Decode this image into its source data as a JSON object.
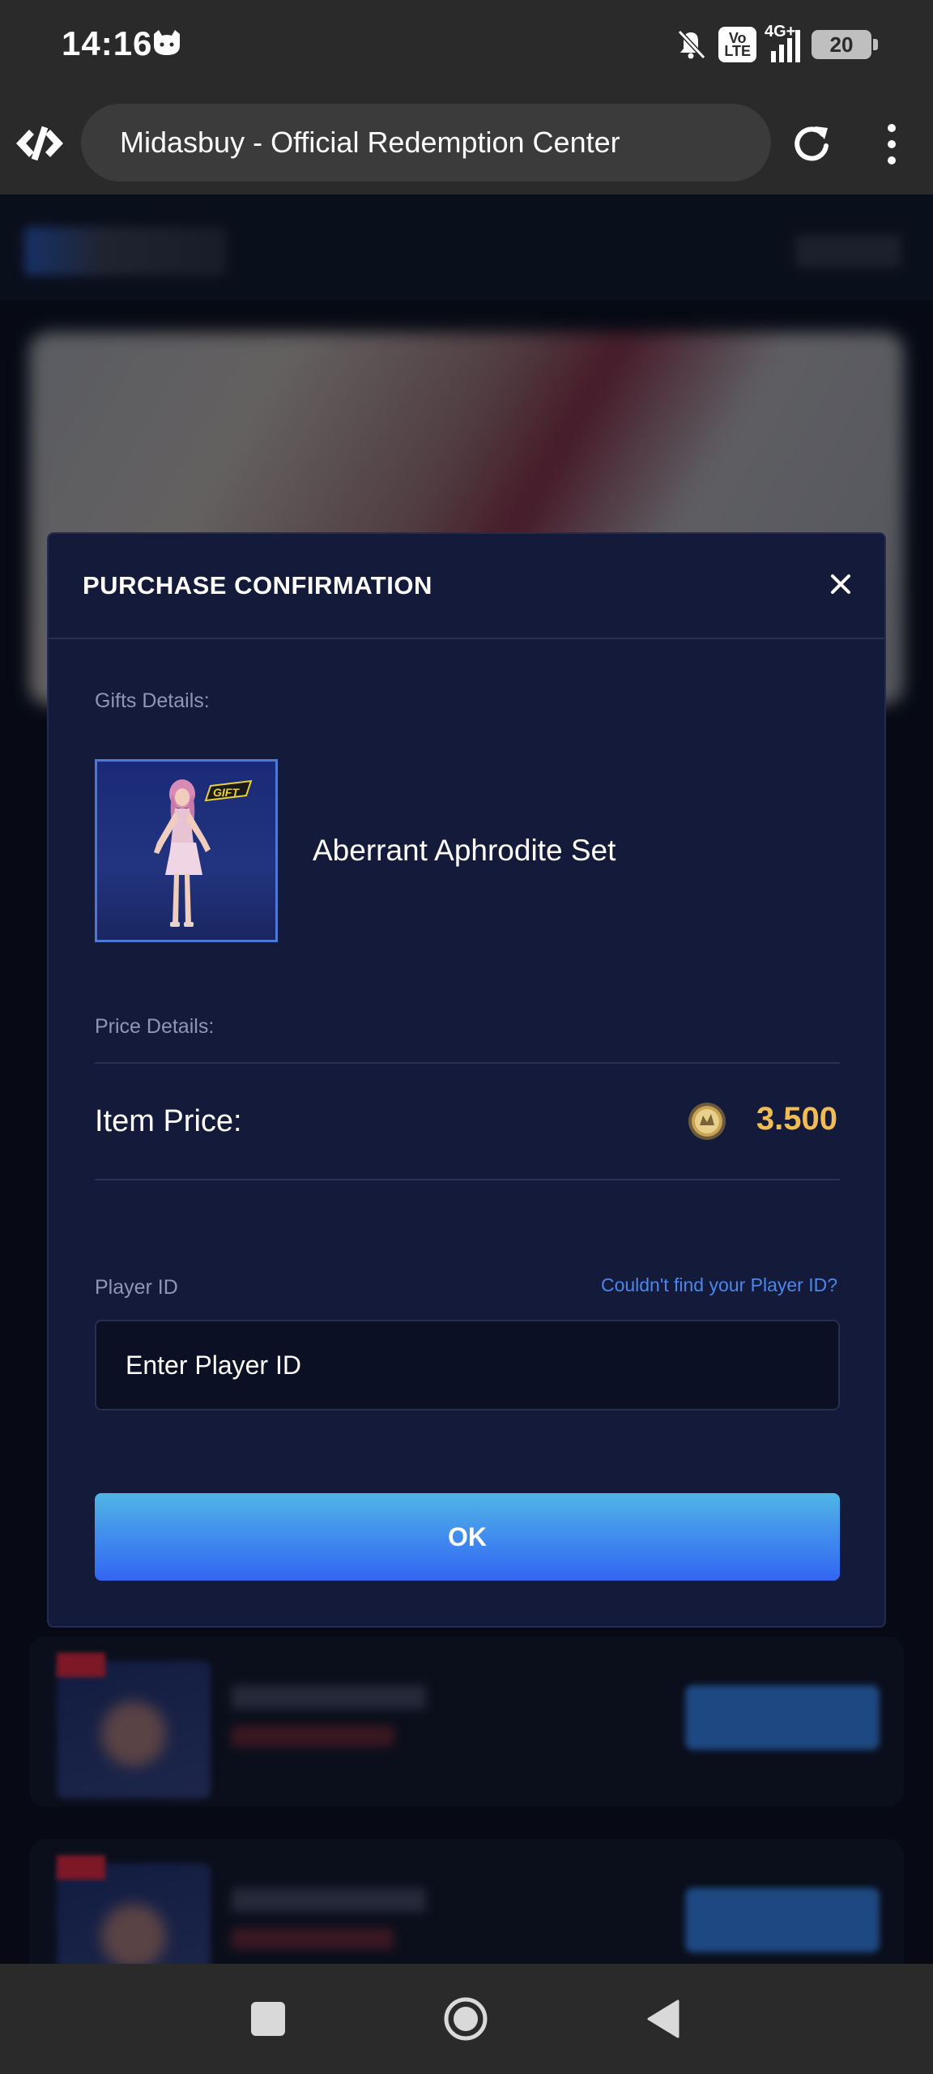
{
  "status_bar": {
    "time": "14:16",
    "volte_label": "Vo\nLTE",
    "network_label": "4G+",
    "battery_level": "20",
    "icons": [
      "cat-face-icon",
      "bell-muted-icon",
      "volte-icon",
      "signal-icon",
      "battery-icon"
    ]
  },
  "browser": {
    "url_title": "Midasbuy - Official Redemption Center",
    "icons": [
      "midasbuy-logo-icon",
      "reload-icon",
      "more-vert-icon"
    ]
  },
  "modal": {
    "title": "PURCHASE CONFIRMATION",
    "gifts_label": "Gifts Details:",
    "gift_name": "Aberrant Aphrodite Set",
    "gift_badge": "GIFT",
    "price_label": "Price Details:",
    "item_price_label": "Item Price:",
    "item_price_value": "3.500",
    "player_id_label": "Player ID",
    "help_link": "Couldn't find your Player ID?",
    "player_id_placeholder": "Enter Player ID",
    "ok_label": "OK"
  },
  "colors": {
    "modal_bg": "#141b3a",
    "price": "#f0bc55",
    "link": "#4d86e8",
    "ok_gradient_top": "#4fb6e4",
    "ok_gradient_bottom": "#3366f2"
  }
}
